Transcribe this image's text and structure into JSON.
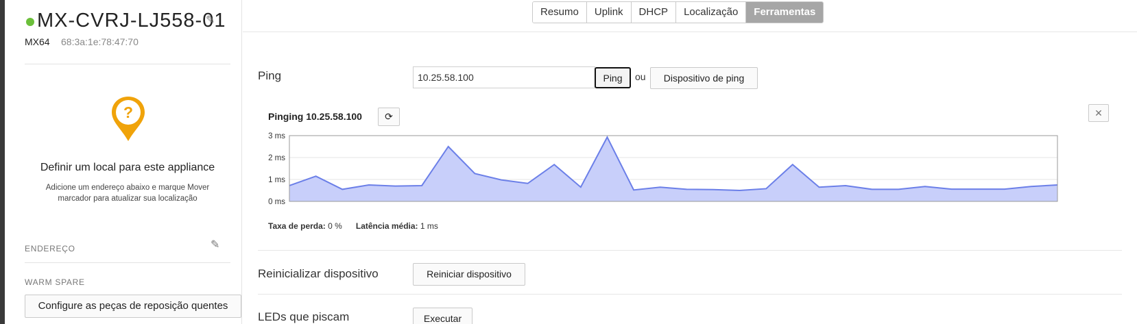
{
  "device": {
    "name": "MX-CVRJ-LJ558-01",
    "model": "MX64",
    "mac": "68:3a:1e:78:47:70",
    "status_color": "#6bbf3a"
  },
  "location": {
    "title": "Definir um local para este appliance",
    "description": "Adicione um endereço abaixo e marque Mover marcador para atualizar sua localização",
    "icon": "location-unknown-pin-icon",
    "pin_color": "#f0a30a"
  },
  "sidebar": {
    "address_label": "ENDEREÇO",
    "warm_spare_label": "WARM SPARE",
    "configure_button": "Configure as peças de reposição quentes"
  },
  "tabs": [
    {
      "label": "Resumo",
      "active": false
    },
    {
      "label": "Uplink",
      "active": false
    },
    {
      "label": "DHCP",
      "active": false
    },
    {
      "label": "Localização",
      "active": false
    },
    {
      "label": "Ferramentas",
      "active": true
    }
  ],
  "ping": {
    "label": "Ping",
    "input_value": "10.25.58.100",
    "button": "Ping",
    "or_text": "ou",
    "device_button": "Dispositivo de ping",
    "result_title": "Pinging 10.25.58.100",
    "refresh_icon": "refresh-icon",
    "close_icon": "close-icon",
    "loss_label": "Taxa de perda:",
    "loss_value": "0 %",
    "latency_label": "Latência média:",
    "latency_value": "1 ms"
  },
  "chart_data": {
    "type": "area",
    "title": "",
    "xlabel": "",
    "ylabel": "",
    "ylim": [
      0,
      3
    ],
    "yticks": [
      "3 ms",
      "2 ms",
      "1 ms",
      "0 ms"
    ],
    "grid": true,
    "color": "#6b7fe8",
    "fill": "#c8cffa",
    "series": [
      {
        "values": [
          0.72,
          1.15,
          0.55,
          0.75,
          0.7,
          0.72,
          2.5,
          1.27,
          0.98,
          0.82,
          1.68,
          0.65,
          2.93,
          0.52,
          0.65,
          0.55,
          0.54,
          0.5,
          0.58,
          1.68,
          0.65,
          0.72,
          0.55,
          0.55,
          0.68,
          0.56,
          0.56,
          0.56,
          0.68,
          0.75
        ]
      }
    ]
  },
  "reboot": {
    "label": "Reinicializar dispositivo",
    "button": "Reiniciar dispositivo"
  },
  "leds": {
    "label": "LEDs que piscam",
    "button": "Executar"
  }
}
